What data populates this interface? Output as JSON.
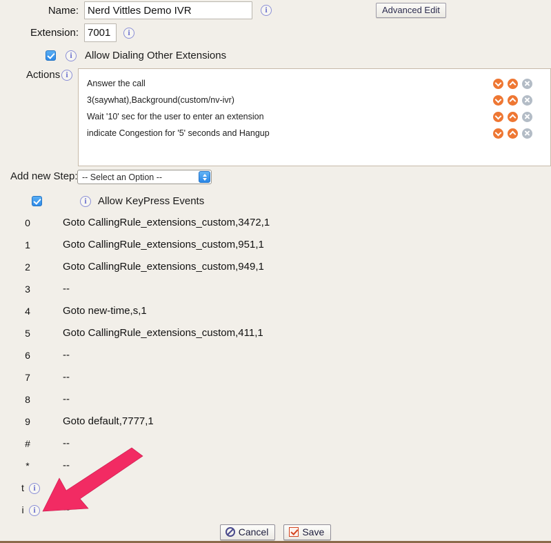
{
  "form": {
    "name": {
      "label": "Name:",
      "value": "Nerd Vittles Demo IVR",
      "info_icon": "info-icon"
    },
    "extension": {
      "label": "Extension:",
      "value": "7001",
      "info_icon": "info-icon"
    },
    "allow_dialing": {
      "label": "Allow Dialing Other Extensions",
      "checked": true,
      "info_icon": "info-icon"
    },
    "advanced_edit_label": "Advanced Edit"
  },
  "actions": {
    "label": "Actions",
    "info_icon": "info-icon",
    "rows": [
      {
        "text": "Answer the call"
      },
      {
        "text": "3(saywhat),Background(custom/nv-ivr)"
      },
      {
        "text": "Wait '10' sec for the user to enter an extension"
      },
      {
        "text": "indicate Congestion for '5' seconds and Hangup"
      }
    ],
    "row_icons": {
      "move_down": "chevron-down-circle-icon",
      "move_up": "chevron-up-circle-icon",
      "delete": "delete-circle-icon"
    }
  },
  "add_step": {
    "label": "Add new Step:",
    "selected_option": "-- Select an Option --",
    "options": [
      "-- Select an Option --"
    ]
  },
  "keypress": {
    "header_label": "Allow KeyPress Events",
    "header_checked": true,
    "header_info_icon": "info-icon",
    "rows": [
      {
        "key": "0",
        "value": "Goto CallingRule_extensions_custom,3472,1",
        "has_info": false
      },
      {
        "key": "1",
        "value": "Goto CallingRule_extensions_custom,951,1",
        "has_info": false
      },
      {
        "key": "2",
        "value": "Goto CallingRule_extensions_custom,949,1",
        "has_info": false
      },
      {
        "key": "3",
        "value": "--",
        "has_info": false
      },
      {
        "key": "4",
        "value": "Goto new-time,s,1",
        "has_info": false
      },
      {
        "key": "5",
        "value": "Goto CallingRule_extensions_custom,411,1",
        "has_info": false
      },
      {
        "key": "6",
        "value": "--",
        "has_info": false
      },
      {
        "key": "7",
        "value": "--",
        "has_info": false
      },
      {
        "key": "8",
        "value": "--",
        "has_info": false
      },
      {
        "key": "9",
        "value": "Goto default,7777,1",
        "has_info": false
      },
      {
        "key": "#",
        "value": "--",
        "has_info": false
      },
      {
        "key": "*",
        "value": "--",
        "has_info": false
      },
      {
        "key": "t",
        "value": "",
        "has_info": true
      },
      {
        "key": "i",
        "value": "--",
        "has_info": true
      }
    ]
  },
  "footer": {
    "cancel_label": "Cancel",
    "save_label": "Save",
    "cancel_icon": "no-entry-icon",
    "save_icon": "checkbox-check-icon"
  },
  "annotation": {
    "arrow_color": "#F22B63",
    "name": "pink-pointer-arrow"
  },
  "colors": {
    "page_background": "#f2efe9",
    "accent_orange": "#ee7733",
    "accent_blue": "#2f8ae8",
    "info_blue": "#6f74cf",
    "bottom_rule": "#8a6a4a"
  }
}
